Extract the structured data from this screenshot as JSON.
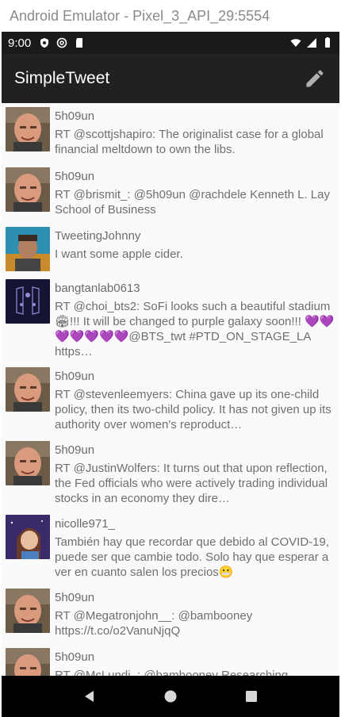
{
  "window": {
    "title": "Android Emulator - Pixel_3_API_29:5554"
  },
  "status_bar": {
    "time": "9:00"
  },
  "app_bar": {
    "title": "SimpleTweet",
    "compose_icon": "pencil-icon"
  },
  "tweets": [
    {
      "user": "5h09un",
      "avatar": "avatar-man",
      "text": "RT @scottjshapiro: The originalist case for a global financial meltdown to own the libs."
    },
    {
      "user": "5h09un",
      "avatar": "avatar-man",
      "text": "RT @brismit_: @5h09un @rachdele Kenneth L. Lay School of Business"
    },
    {
      "user": "TweetingJohnny",
      "avatar": "avatar-johnny",
      "text": "I want some apple cider."
    },
    {
      "user": "bangtanlab0613",
      "avatar": "avatar-bangtan",
      "text": "RT @choi_bts2: SoFi looks such a beautiful stadium 🏟!!! It will be changed to purple galaxy soon!!! 💜💜💜💜💜💜💜@BTS_twt #PTD_ON_STAGE_LA https…"
    },
    {
      "user": "5h09un",
      "avatar": "avatar-man",
      "text": "RT @stevenleemyers: China gave up its one-child policy, then its two-child policy. It has not given up its authority over women's reproduct…"
    },
    {
      "user": "5h09un",
      "avatar": "avatar-man",
      "text": "RT @JustinWolfers: It turns out that upon reflection, the Fed officials who were actively trading individual stocks in an economy they dire…"
    },
    {
      "user": "nicolle971_",
      "avatar": "avatar-nicolle",
      "text": "También hay que recordar que debido al COVID-19, puede ser que cambie todo. Solo hay que esperar a ver en cuanto salen los precios😬"
    },
    {
      "user": "5h09un",
      "avatar": "avatar-man",
      "text": "RT @Megatronjohn__: @bambooney https://t.co/o2VanuNjqQ"
    },
    {
      "user": "5h09un",
      "avatar": "avatar-man",
      "text": "RT @McLundi_: @bambooney Researching"
    }
  ],
  "colors": {
    "app_bar": "#212121",
    "status_bar": "#1a1a1a",
    "timeline_bg": "#fafafa",
    "text": "#6f6f6f"
  }
}
